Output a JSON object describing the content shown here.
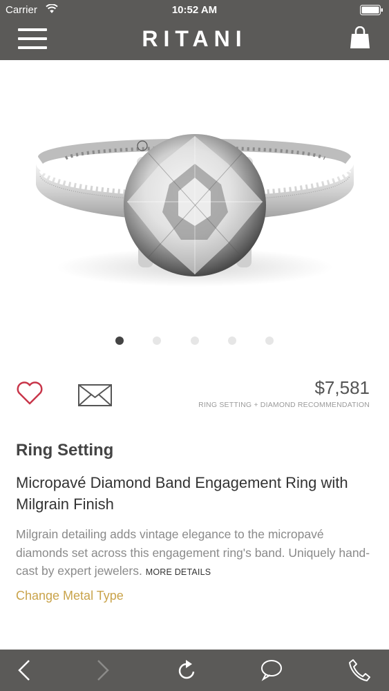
{
  "status_bar": {
    "carrier": "Carrier",
    "time": "10:52 AM"
  },
  "header": {
    "brand": "RITANI",
    "icons": [
      "menu-icon",
      "shopping-bag-icon"
    ]
  },
  "gallery": {
    "pages": 5,
    "active_index": 0
  },
  "price": {
    "amount": "$7,581",
    "caption": "RING SETTING + DIAMOND RECOMMENDATION"
  },
  "actions": {
    "icons": [
      "heart-icon",
      "mail-icon"
    ]
  },
  "product": {
    "section_title": "Ring Setting",
    "name": "Micropavé Diamond Band Engagement Ring with Milgrain Finish",
    "description": "Milgrain detailing adds vintage elegance to the micropavé diamonds set across this engagement ring's band. Uniquely hand-cast by expert jewelers.",
    "more_details": "MORE DETAILS",
    "change_metal": "Change Metal Type"
  },
  "toolbar": {
    "icons": [
      "back-icon",
      "forward-icon",
      "refresh-icon",
      "chat-icon",
      "phone-icon"
    ]
  },
  "colors": {
    "header_bg": "#5b5a58",
    "accent_gold": "#c9a34a",
    "heart_red": "#c8364a"
  }
}
